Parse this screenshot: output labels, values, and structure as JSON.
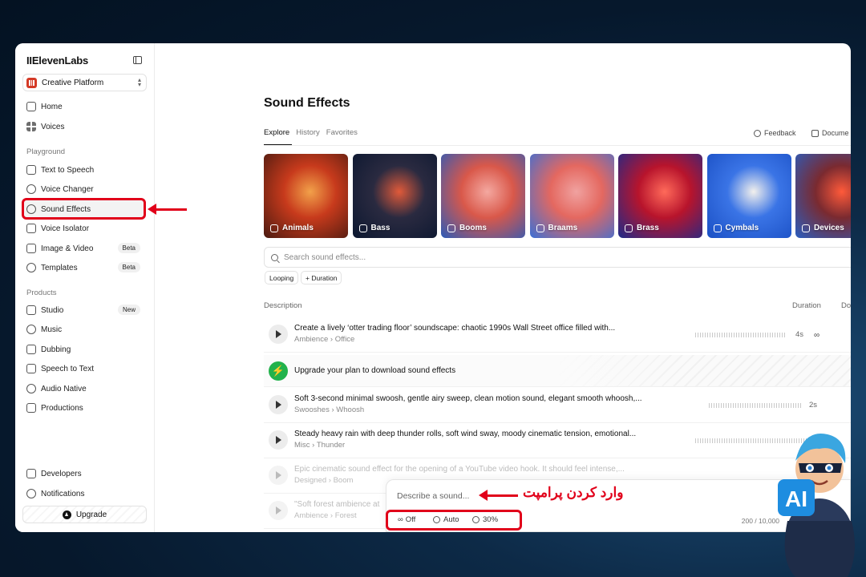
{
  "sidebar": {
    "logo": "IIElevenLabs",
    "platform": "Creative Platform",
    "items_top": [
      {
        "label": "Home",
        "icon": "home-icon"
      },
      {
        "label": "Voices",
        "icon": "grid-icon"
      }
    ],
    "playground_label": "Playground",
    "playground": [
      {
        "label": "Text to Speech",
        "icon": "text-speech-icon"
      },
      {
        "label": "Voice Changer",
        "icon": "voice-changer-icon"
      },
      {
        "label": "Sound Effects",
        "icon": "sound-effects-icon"
      },
      {
        "label": "Voice Isolator",
        "icon": "isolator-icon"
      },
      {
        "label": "Image & Video",
        "icon": "image-video-icon",
        "badge": "Beta"
      },
      {
        "label": "Templates",
        "icon": "templates-icon",
        "badge": "Beta"
      }
    ],
    "products_label": "Products",
    "products": [
      {
        "label": "Studio",
        "icon": "studio-icon",
        "badge": "New"
      },
      {
        "label": "Music",
        "icon": "music-icon"
      },
      {
        "label": "Dubbing",
        "icon": "dubbing-icon"
      },
      {
        "label": "Speech to Text",
        "icon": "stt-icon"
      },
      {
        "label": "Audio Native",
        "icon": "globe-icon"
      },
      {
        "label": "Productions",
        "icon": "productions-icon"
      }
    ],
    "bottom": [
      {
        "label": "Developers",
        "icon": "code-icon"
      },
      {
        "label": "Notifications",
        "icon": "bell-icon"
      }
    ],
    "upgrade": "Upgrade"
  },
  "main": {
    "title": "Sound Effects",
    "tabs": [
      "Explore",
      "History",
      "Favorites"
    ],
    "feedback": "Feedback",
    "docs": "Docume",
    "categories": [
      {
        "label": "Animals",
        "colors": [
          "#f2a14a",
          "#c73a1c",
          "#4a1a10"
        ]
      },
      {
        "label": "Bass",
        "colors": [
          "#e05a3a",
          "#2a2a40",
          "#0b1730"
        ]
      },
      {
        "label": "Booms",
        "colors": [
          "#f4a8a0",
          "#d9584a",
          "#2b5ab8"
        ]
      },
      {
        "label": "Braams",
        "colors": [
          "#f0a2a0",
          "#e46860",
          "#3a6fd6"
        ]
      },
      {
        "label": "Brass",
        "colors": [
          "#ff6a5a",
          "#b8142c",
          "#1d2a8a"
        ]
      },
      {
        "label": "Cymbals",
        "colors": [
          "#f2f0ec",
          "#3a74e6",
          "#1a4fc4"
        ]
      },
      {
        "label": "Devices",
        "colors": [
          "#ff5a3a",
          "#7a2a30",
          "#2a5ec0"
        ]
      }
    ],
    "search_placeholder": "Search sound effects...",
    "chips": [
      "Looping",
      "+ Duration"
    ],
    "columns": {
      "description": "Description",
      "duration": "Duration",
      "do": "Do"
    },
    "rows": [
      {
        "title": "Create a lively ‘otter trading floor’ soundscape: chaotic 1990s Wall Street office filled with...",
        "category": "Ambience",
        "sub": "Office",
        "duration": "4s"
      },
      {
        "title": "Soft 3-second minimal swoosh, gentle airy sweep, clean motion sound, elegant smooth whoosh,...",
        "category": "Swooshes",
        "sub": "Whoosh",
        "duration": "2s"
      },
      {
        "title": "Steady heavy rain with deep thunder rolls, soft wind sway, moody cinematic tension, emotional...",
        "category": "Misc",
        "sub": "Thunder",
        "duration": ""
      },
      {
        "title": "Epic cinematic sound effect for the opening of a YouTube video hook. It should feel intense,...",
        "category": "Designed",
        "sub": "Boom",
        "duration": ""
      },
      {
        "title": "\"Soft forest ambience at",
        "category": "Ambience",
        "sub": "Forest",
        "duration": ""
      }
    ],
    "upgrade_banner": "Upgrade your plan to download sound effects",
    "prompt": {
      "placeholder": "Describe a sound...",
      "loop": "Off",
      "duration": "Auto",
      "influence": "30%",
      "counter": "200 / 10,000"
    }
  },
  "annotation": {
    "persian_text": "وارد کردن پرامپت",
    "color": "#e1001a"
  },
  "mascot": {
    "badge": "AI"
  }
}
